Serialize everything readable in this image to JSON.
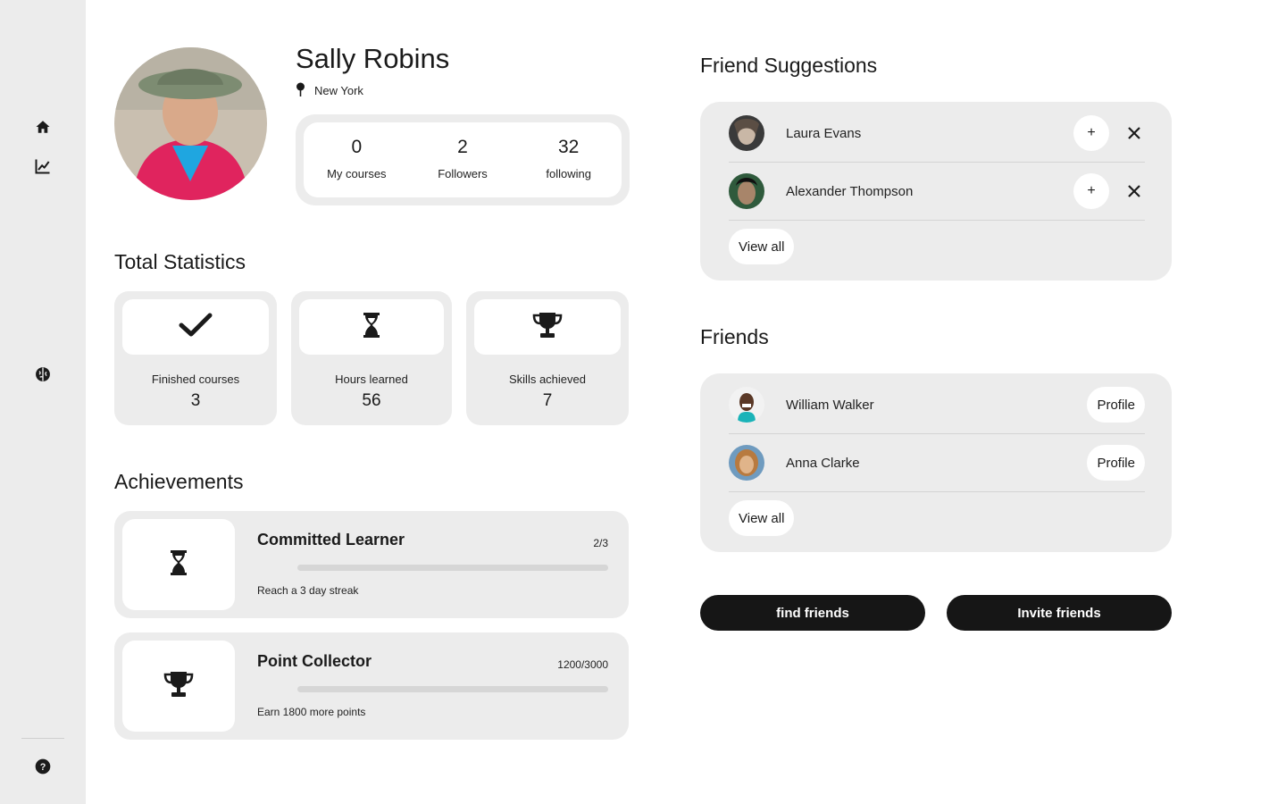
{
  "sidebar": {
    "icons": [
      "home-icon",
      "chart-icon",
      "brain-icon",
      "help-icon"
    ]
  },
  "profile": {
    "name": "Sally Robins",
    "location": "New York",
    "stats": [
      {
        "value": "0",
        "label": "My courses"
      },
      {
        "value": "2",
        "label": "Followers"
      },
      {
        "value": "32",
        "label": "following"
      }
    ]
  },
  "total_statistics": {
    "title": "Total Statistics",
    "cards": [
      {
        "icon": "checkmark-icon",
        "label": "Finished courses",
        "value": "3"
      },
      {
        "icon": "hourglass-icon",
        "label": "Hours learned",
        "value": "56"
      },
      {
        "icon": "trophy-icon",
        "label": "Skills achieved",
        "value": "7"
      }
    ]
  },
  "achievements": {
    "title": "Achievements",
    "items": [
      {
        "icon": "hourglass-icon",
        "title": "Committed Learner",
        "count": "2/3",
        "progress": 0.0,
        "description": "Reach a 3 day streak"
      },
      {
        "icon": "trophy-icon",
        "title": "Point Collector",
        "count": "1200/3000",
        "progress": 0.0,
        "description": "Earn 1800 more points"
      }
    ]
  },
  "friend_suggestions": {
    "title": "Friend Suggestions",
    "items": [
      {
        "name": "Laura Evans",
        "add_label": "+"
      },
      {
        "name": "Alexander Thompson",
        "add_label": "+"
      }
    ],
    "view_all": "View all"
  },
  "friends": {
    "title": "Friends",
    "items": [
      {
        "name": "William Walker",
        "action": "Profile"
      },
      {
        "name": "Anna Clarke",
        "action": "Profile"
      }
    ],
    "view_all": "View all"
  },
  "actions": {
    "find_friends": "find friends",
    "invite_friends": "Invite friends"
  },
  "colors": {
    "sidebar_bg": "#ececec",
    "card_bg": "#ececec",
    "button_dark": "#161616",
    "accent_pink": "#e0245e"
  }
}
